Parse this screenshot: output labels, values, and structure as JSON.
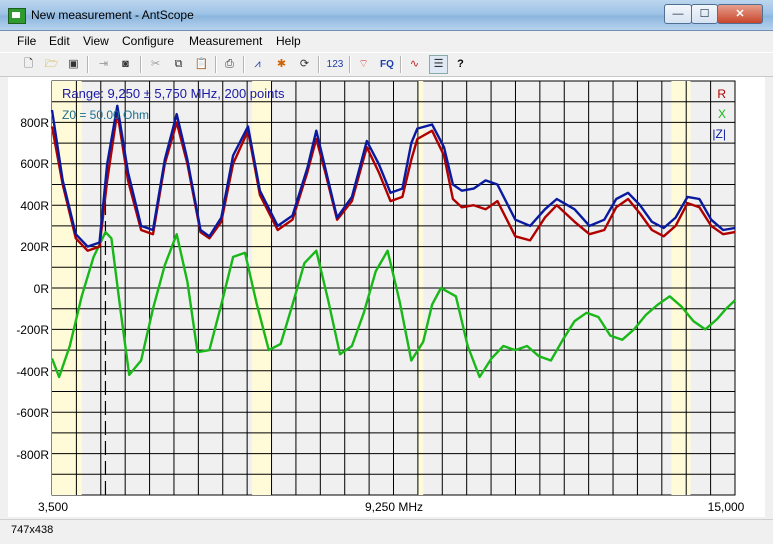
{
  "window": {
    "title": "New measurement - AntScope",
    "minimize_glyph": "—",
    "maximize_glyph": "☐",
    "close_glyph": "✕"
  },
  "menu": {
    "items": [
      "File",
      "Edit",
      "View",
      "Configure",
      "Measurement",
      "Help"
    ]
  },
  "toolbar": {
    "icons": [
      "new-file-icon",
      "open-folder-icon",
      "save-icon",
      "export-icon",
      "camera-icon",
      "cut-icon",
      "copy-icon",
      "paste-icon",
      "print-icon",
      "graph-icon",
      "marker-icon",
      "refresh-icon",
      "numbers-icon",
      "antenna-icon",
      "fq-icon",
      "curves-icon",
      "list-icon",
      "help-icon"
    ],
    "numbers_label": "123",
    "fq_label": "FQ",
    "help_label": "?"
  },
  "chart": {
    "range_label": "Range: 9,250 ± 5,750 MHz, 200 points",
    "z0_label": "Z0 = 50.00 Ohm",
    "legend": [
      {
        "name": "R",
        "color": "#b00000"
      },
      {
        "name": "X",
        "color": "#18b818"
      },
      {
        "name": "|Z|",
        "color": "#0a1aa0"
      }
    ],
    "x_labels": {
      "left": "3,500",
      "center": "9,250 MHz",
      "right": "15,000"
    },
    "y_labels": [
      "800R",
      "600R",
      "400R",
      "200R",
      "0R",
      "-200R",
      "-400R",
      "-600R",
      "-800R"
    ]
  },
  "chart_data": {
    "type": "line",
    "title": "Range: 9,250 ± 5,750 MHz, 200 points",
    "xlabel": "MHz",
    "ylabel": "",
    "xlim": [
      3.5,
      15.0
    ],
    "ylim": [
      -1000,
      1000
    ],
    "y_ticks": [
      800,
      600,
      400,
      200,
      0,
      -200,
      -400,
      -600,
      -800
    ],
    "grid": true,
    "legend_position": "top-right",
    "series": [
      {
        "name": "R",
        "color": "#b00000",
        "x": [
          3.5,
          3.68,
          3.9,
          4.1,
          4.3,
          4.43,
          4.6,
          4.78,
          5.0,
          5.2,
          5.4,
          5.6,
          5.78,
          6.0,
          6.15,
          6.35,
          6.55,
          6.8,
          7.0,
          7.3,
          7.55,
          7.8,
          7.95,
          8.1,
          8.3,
          8.55,
          8.8,
          9.0,
          9.2,
          9.4,
          9.55,
          9.65,
          9.9,
          10.1,
          10.25,
          10.4,
          10.6,
          10.8,
          11.0,
          11.3,
          11.55,
          11.8,
          12.0,
          12.3,
          12.55,
          12.8,
          13.0,
          13.2,
          13.4,
          13.6,
          13.8,
          14.0,
          14.2,
          14.4,
          14.6,
          14.8,
          15.0
        ],
        "y": [
          780,
          500,
          240,
          180,
          200,
          520,
          850,
          520,
          280,
          260,
          600,
          800,
          600,
          270,
          240,
          320,
          600,
          760,
          450,
          280,
          330,
          560,
          720,
          560,
          330,
          420,
          680,
          560,
          420,
          440,
          620,
          720,
          760,
          640,
          430,
          390,
          400,
          380,
          420,
          250,
          230,
          340,
          400,
          320,
          260,
          280,
          390,
          430,
          360,
          280,
          250,
          300,
          410,
          390,
          300,
          260,
          270
        ]
      },
      {
        "name": "X",
        "color": "#18b818",
        "x": [
          3.5,
          3.62,
          3.8,
          4.0,
          4.2,
          4.4,
          4.5,
          4.65,
          4.8,
          5.0,
          5.2,
          5.4,
          5.6,
          5.78,
          5.95,
          6.15,
          6.35,
          6.55,
          6.75,
          6.95,
          7.15,
          7.35,
          7.55,
          7.75,
          7.95,
          8.15,
          8.35,
          8.55,
          8.75,
          8.95,
          9.15,
          9.35,
          9.55,
          9.75,
          9.9,
          10.05,
          10.3,
          10.5,
          10.7,
          10.9,
          11.1,
          11.3,
          11.5,
          11.7,
          11.9,
          12.1,
          12.3,
          12.5,
          12.7,
          12.9,
          13.1,
          13.3,
          13.5,
          13.7,
          13.9,
          14.1,
          14.3,
          14.5,
          14.7,
          14.85,
          15.0
        ],
        "y": [
          -340,
          -430,
          -280,
          -40,
          150,
          270,
          240,
          -100,
          -420,
          -350,
          -100,
          110,
          260,
          30,
          -310,
          -300,
          -80,
          150,
          170,
          -80,
          -300,
          -270,
          -80,
          120,
          180,
          -60,
          -320,
          -280,
          -120,
          80,
          180,
          -60,
          -350,
          -260,
          -80,
          0,
          -40,
          -280,
          -430,
          -340,
          -280,
          -300,
          -280,
          -330,
          -350,
          -250,
          -160,
          -120,
          -140,
          -230,
          -250,
          -200,
          -130,
          -80,
          -40,
          -90,
          -160,
          -200,
          -150,
          -100,
          -60
        ]
      },
      {
        "name": "|Z|",
        "color": "#0a1aa0",
        "x": [
          3.5,
          3.68,
          3.9,
          4.1,
          4.3,
          4.43,
          4.6,
          4.78,
          5.0,
          5.2,
          5.4,
          5.6,
          5.78,
          6.0,
          6.15,
          6.35,
          6.55,
          6.8,
          7.0,
          7.3,
          7.55,
          7.8,
          7.95,
          8.1,
          8.3,
          8.55,
          8.8,
          9.0,
          9.2,
          9.4,
          9.55,
          9.65,
          9.9,
          10.1,
          10.25,
          10.4,
          10.6,
          10.8,
          11.0,
          11.3,
          11.55,
          11.8,
          12.0,
          12.3,
          12.55,
          12.8,
          13.0,
          13.2,
          13.4,
          13.6,
          13.8,
          14.0,
          14.2,
          14.4,
          14.6,
          14.8,
          15.0
        ],
        "y": [
          860,
          520,
          260,
          200,
          220,
          600,
          880,
          560,
          300,
          280,
          620,
          840,
          620,
          280,
          250,
          340,
          640,
          780,
          470,
          300,
          350,
          580,
          760,
          580,
          340,
          440,
          710,
          600,
          460,
          480,
          700,
          770,
          790,
          680,
          500,
          470,
          480,
          520,
          500,
          330,
          300,
          380,
          430,
          380,
          300,
          330,
          430,
          460,
          400,
          320,
          290,
          340,
          440,
          430,
          330,
          280,
          290
        ]
      }
    ]
  },
  "status": {
    "text": "747x438"
  }
}
